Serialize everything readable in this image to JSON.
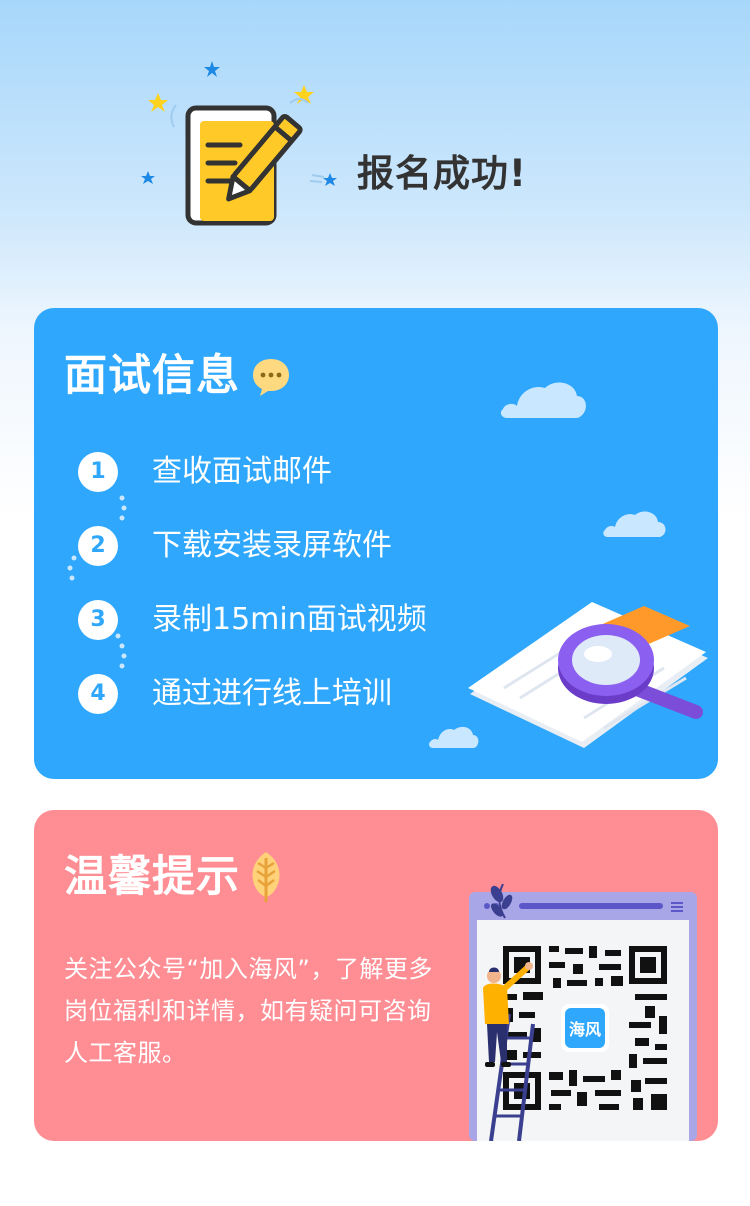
{
  "header": {
    "title": "报名成功!"
  },
  "interview": {
    "title": "面试信息",
    "steps": [
      {
        "num": "1",
        "label": "查收面试邮件"
      },
      {
        "num": "2",
        "label": "下载安装录屏软件"
      },
      {
        "num": "3",
        "label": "录制15min面试视频"
      },
      {
        "num": "4",
        "label": "通过进行线上培训"
      }
    ]
  },
  "tips": {
    "title": "温馨提示",
    "text": "关注公众号“加入海风”，了解更多岗位福利和详情，如有疑问可咨询人工客服。",
    "qr_logo_text": "海风"
  },
  "colors": {
    "blue_card": "#2ea7fc",
    "pink_card": "#ff8d94",
    "title_dark": "#333333",
    "yellow": "#ffc928",
    "purple": "#7c4dd8"
  },
  "icons": {
    "header": "document-pencil-icon",
    "interview": "chat-bubble-icon",
    "tips": "leaf-icon"
  }
}
